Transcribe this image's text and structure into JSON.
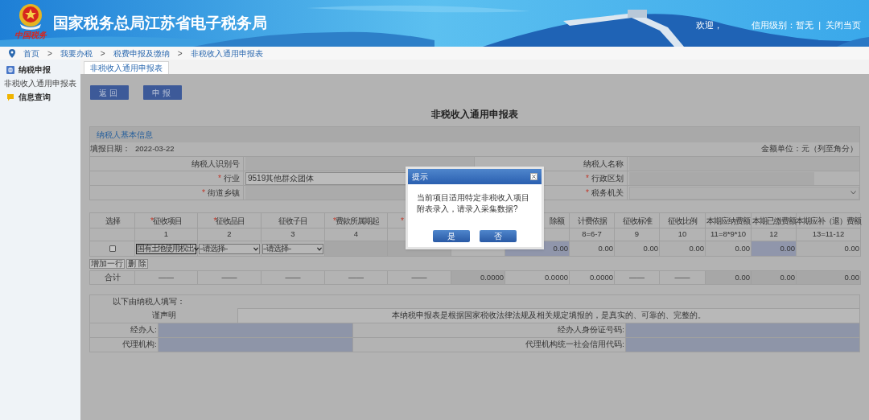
{
  "header": {
    "title": "国家税务总局江苏省电子税务局",
    "logo_text": "中国税务",
    "welcome": "欢迎，",
    "credit": "信用级别：暂无",
    "separator": "|",
    "close_link": "关闭当页"
  },
  "breadcrumb": {
    "separator": ">",
    "items": [
      "首页",
      "我要办税",
      "税费申报及缴纳",
      "非税收入通用申报表"
    ]
  },
  "sidebar": {
    "items": [
      {
        "label": "纳税申报",
        "kind": "declare",
        "children": [
          {
            "label": "非税收入通用申报表"
          }
        ]
      },
      {
        "label": "信息查询",
        "kind": "query"
      }
    ]
  },
  "tabs": [
    {
      "label": "非税收入通用申报表",
      "selected": true
    }
  ],
  "actions": [
    "返回",
    "申报"
  ],
  "form": {
    "title": "非税收入通用申报表",
    "section": "纳税人基本信息",
    "date_label": "填报日期：",
    "date": "2022-03-22",
    "unit": "金额单位：元（列至角分）",
    "required_mark": "*",
    "info_rows": [
      [
        {
          "label": "纳税人识别号",
          "required": false,
          "kind": "text"
        },
        {
          "label": "纳税人名称",
          "required": false,
          "kind": "text"
        }
      ],
      [
        {
          "label": "行业",
          "required": true,
          "kind": "input",
          "value": "9519其他群众团体"
        },
        {
          "label": "行政区划",
          "required": true,
          "kind": "input"
        }
      ],
      [
        {
          "label": "街道乡镇",
          "required": true,
          "kind": "text"
        },
        {
          "label": "税务机关",
          "required": true,
          "kind": "select"
        }
      ]
    ]
  },
  "table": {
    "columns": [
      {
        "header": "选择",
        "required": false
      },
      {
        "header": "征收项目",
        "required": true,
        "index": "1"
      },
      {
        "header": "征收品目",
        "required": true,
        "index": "2"
      },
      {
        "header": "征收子目",
        "required": false,
        "index": "3"
      },
      {
        "header": "费款所属期起",
        "required": true,
        "index": "4"
      },
      {
        "required": true
      },
      null,
      {
        "header": "除额",
        "required": false
      },
      {
        "header": "计费依据",
        "required": false,
        "index": "8=6-7"
      },
      {
        "header": "征收标准",
        "required": false,
        "index": "9"
      },
      {
        "header": "征收比例",
        "required": false,
        "index": "10"
      },
      {
        "header": "本期应纳费额",
        "required": false,
        "index": "11=8*9*10"
      },
      {
        "header": "本期已缴费额",
        "required": false,
        "index": "12"
      },
      {
        "header": "本期应补（退）费额",
        "required": false,
        "index": "13=11-12"
      }
    ],
    "rows": [
      {
        "cells": [
          {
            "kind": "checkbox",
            "checked": false
          },
          {
            "kind": "select",
            "value": "国有土地使用权出",
            "focused": true
          },
          {
            "kind": "select",
            "value": "--请选择--",
            "focused": false
          },
          {
            "kind": "select",
            "value": "--请选择--",
            "focused": false
          },
          {
            "kind": "locked"
          },
          {
            "kind": "locked"
          },
          {
            "kind": "covered"
          },
          {
            "kind": "amount",
            "value": "0.00",
            "editable": true
          },
          {
            "kind": "amount",
            "value": "0.00",
            "editable": false
          },
          {
            "kind": "amount",
            "value": "0.00",
            "editable": false
          },
          {
            "kind": "amount",
            "value": "0.00",
            "editable": false
          },
          {
            "kind": "amount",
            "value": "0.00",
            "editable": false
          },
          {
            "kind": "amount",
            "value": "0.00",
            "editable": true
          },
          {
            "kind": "amount",
            "value": "0.00",
            "editable": false
          }
        ]
      }
    ],
    "row_buttons": [
      "增加一行",
      "删 除"
    ],
    "total": {
      "label": "合计",
      "cells": [
        {
          "value": "——",
          "locked": false
        },
        {
          "value": "——",
          "locked": false
        },
        {
          "value": "——",
          "locked": false
        },
        {
          "value": "——",
          "locked": false
        },
        {
          "value": "——",
          "locked": false
        },
        {
          "value": "0.0000",
          "locked": true
        },
        {
          "value": "0.0000",
          "locked": false
        },
        {
          "value": "0.0000",
          "locked": false
        },
        {
          "value": "——",
          "locked": false
        },
        {
          "value": "——",
          "locked": false
        },
        {
          "value": "0.00",
          "locked": true
        },
        {
          "value": "0.00",
          "locked": true
        },
        {
          "value": "0.00",
          "locked": true
        }
      ]
    }
  },
  "declaration": {
    "intro": "以下由纳税人填写：",
    "label": "谨声明",
    "statement": "本纳税申报表是根据国家税收法律法规及相关规定填报的，是真实的、可靠的、完整的。",
    "fields": [
      [
        "经办人:",
        "经办人身份证号码:"
      ],
      [
        "代理机构:",
        "代理机构统一社会信用代码:"
      ]
    ]
  },
  "dialog": {
    "title": "提示",
    "message": "当前项目适用特定非税收入项目附表录入，请录入采集数据?",
    "buttons": [
      "是",
      "否"
    ]
  }
}
